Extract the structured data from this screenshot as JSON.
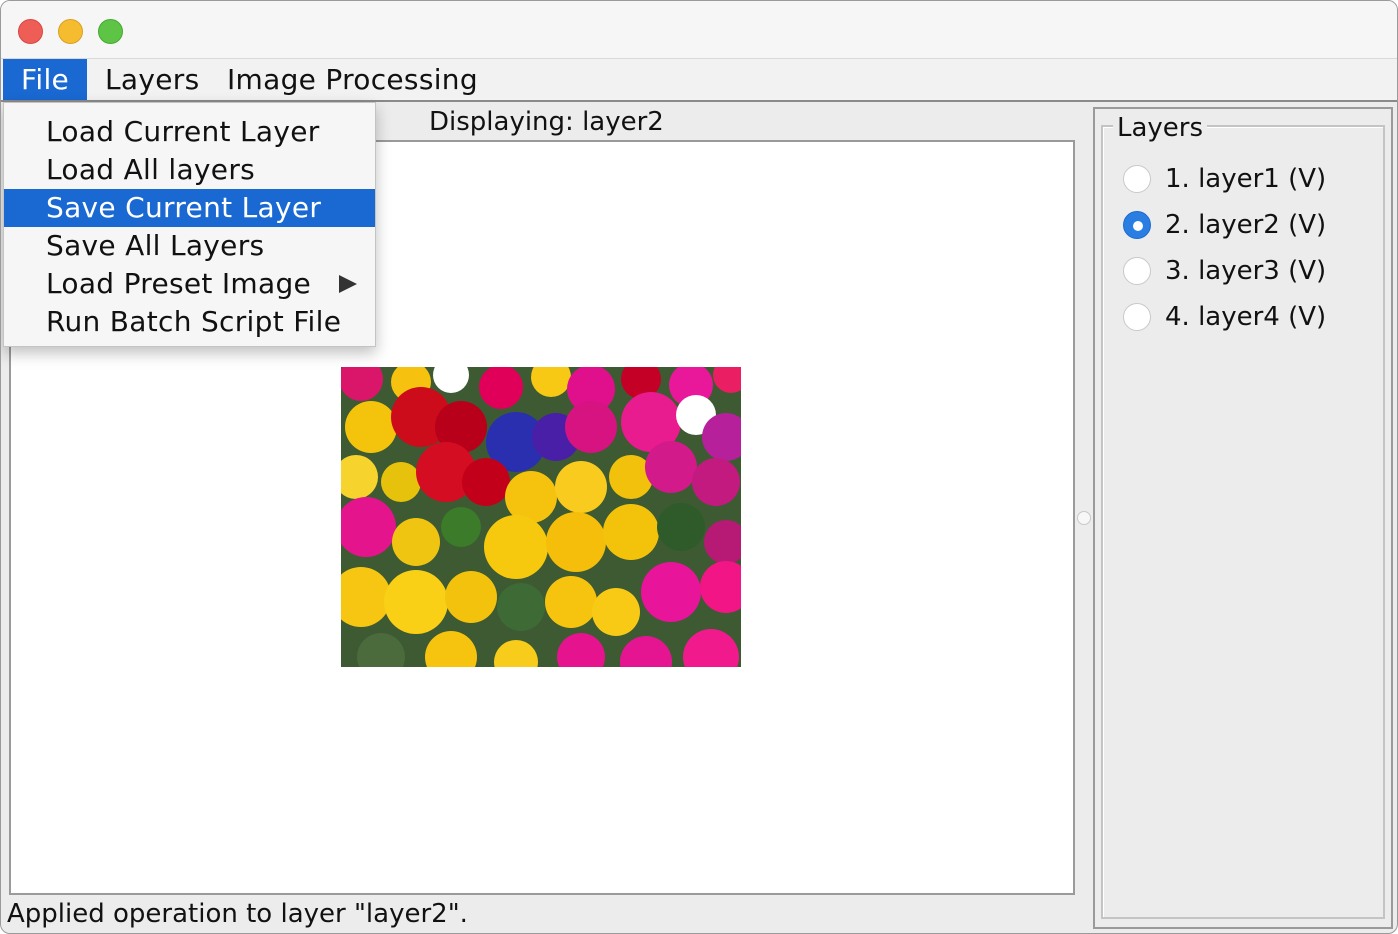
{
  "menubar": {
    "items": [
      {
        "label": "File",
        "active": true
      },
      {
        "label": "Layers",
        "active": false
      },
      {
        "label": "Image Processing",
        "active": false
      }
    ]
  },
  "file_menu": {
    "items": [
      {
        "label": "Load Current Layer"
      },
      {
        "label": "Load All layers"
      },
      {
        "label": "Save Current Layer",
        "highlighted": true
      },
      {
        "label": "Save All Layers"
      },
      {
        "label": "Load Preset Image",
        "submenu": true
      },
      {
        "label": "Run Batch Script File"
      }
    ]
  },
  "display": {
    "label": "Displaying: layer2"
  },
  "image": {
    "subject": "flower bed photo (yellow, red, magenta and purple primroses)"
  },
  "layers_panel": {
    "title": "Layers",
    "items": [
      {
        "label": "1. layer1 (V)",
        "selected": false
      },
      {
        "label": "2. layer2 (V)",
        "selected": true
      },
      {
        "label": "3. layer3 (V)",
        "selected": false
      },
      {
        "label": "4. layer4 (V)",
        "selected": false
      }
    ]
  },
  "status": {
    "text": "Applied operation to layer \"layer2\"."
  },
  "colors": {
    "accent": "#1a68d1",
    "radio_selected": "#2a7de1",
    "window_bg": "#ececec",
    "canvas_bg": "#ffffff"
  }
}
